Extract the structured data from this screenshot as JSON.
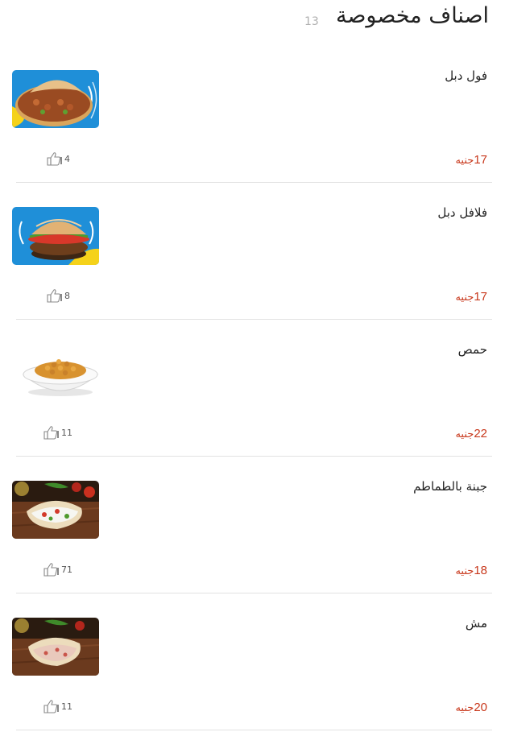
{
  "header": {
    "title": "اصناف مخصوصة",
    "count": "13"
  },
  "currency": "جنيه",
  "items": [
    {
      "name": "فول دبل",
      "price": "17",
      "likes": "4",
      "image": "foul-sandwich"
    },
    {
      "name": "فلافل دبل",
      "price": "17",
      "likes": "8",
      "image": "falafel-sandwich"
    },
    {
      "name": "حمص",
      "price": "22",
      "likes": "11",
      "image": "chickpeas-bowl"
    },
    {
      "name": "جبنة بالطماطم",
      "price": "18",
      "likes": "71",
      "image": "cheese-tomato-pita"
    },
    {
      "name": "مش",
      "price": "20",
      "likes": "11",
      "image": "mish-pita"
    }
  ],
  "colors": {
    "price": "#c8381c",
    "title": "#222222",
    "count": "#b0b0b0",
    "divider": "#e2e2e2",
    "thumb_blue": "#1f8fd8",
    "thumb_yellow": "#f5d21a",
    "thumb_wood": "#6b3a1e"
  },
  "icons": {
    "like": "thumbs-up-icon"
  }
}
